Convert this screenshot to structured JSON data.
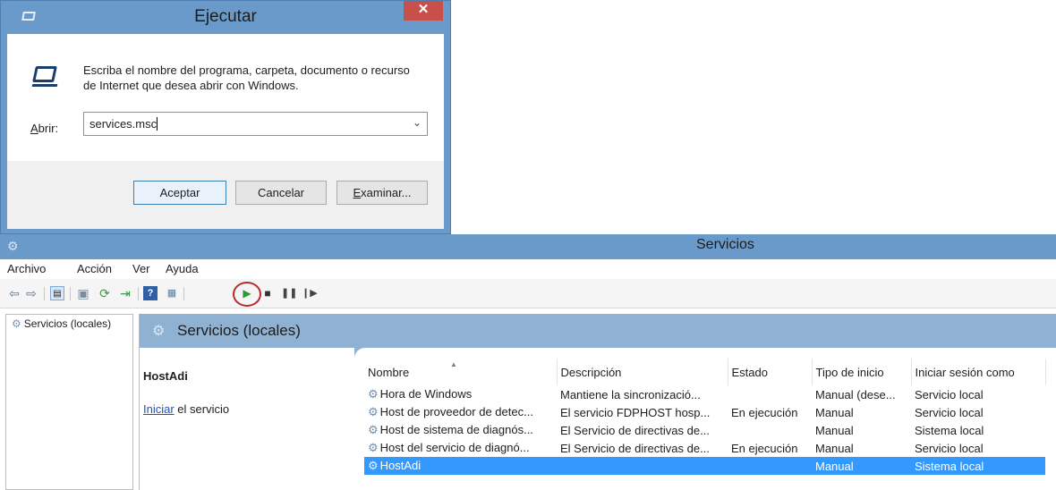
{
  "run_dialog": {
    "title": "Ejecutar",
    "close_glyph": "✕",
    "description": "Escriba el nombre del programa, carpeta, documento o recurso de Internet que desea abrir con Windows.",
    "open_label": "Abrir:",
    "open_value": "services.msc",
    "ok_label": "Aceptar",
    "cancel_label": "Cancelar",
    "browse_label": "Examinar..."
  },
  "services_window": {
    "title": "Servicios",
    "menu": [
      "Archivo",
      "Acción",
      "Ver",
      "Ayuda"
    ],
    "toolbar_icons": [
      "back-arrow-icon",
      "forward-arrow-icon",
      "show-hide-tree-icon",
      "properties-icon",
      "refresh-icon",
      "export-list-icon",
      "help-icon",
      "console-tree-icon",
      "start-service-icon",
      "stop-service-icon",
      "pause-service-icon",
      "resume-service-icon"
    ],
    "tree_item": "Servicios (locales)",
    "header_title": "Servicios (locales)",
    "selected_service_name": "HostAdi",
    "start_link": "Iniciar",
    "start_suffix": " el servicio",
    "columns": [
      "Nombre",
      "Descripción",
      "Estado",
      "Tipo de inicio",
      "Iniciar sesión como"
    ],
    "rows": [
      [
        "Hora de Windows",
        "Mantiene la sincronizació...",
        "",
        "Manual (dese...",
        "Servicio local"
      ],
      [
        "Host de proveedor de detec...",
        "El servicio FDPHOST hosp...",
        "En ejecución",
        "Manual",
        "Servicio local"
      ],
      [
        "Host de sistema de diagnós...",
        "El Servicio de directivas de...",
        "",
        "Manual",
        "Sistema local"
      ],
      [
        "Host del servicio de diagnó...",
        "El Servicio de directivas de...",
        "En ejecución",
        "Manual",
        "Servicio local"
      ],
      [
        "HostAdi",
        "",
        "",
        "Manual",
        "Sistema local"
      ]
    ],
    "selected_row_index": 4
  },
  "colors": {
    "titlebar": "#6a9ac9",
    "header_band": "#8fb2d3",
    "selection": "#3399ff",
    "highlight_ring": "#b52a2a"
  }
}
